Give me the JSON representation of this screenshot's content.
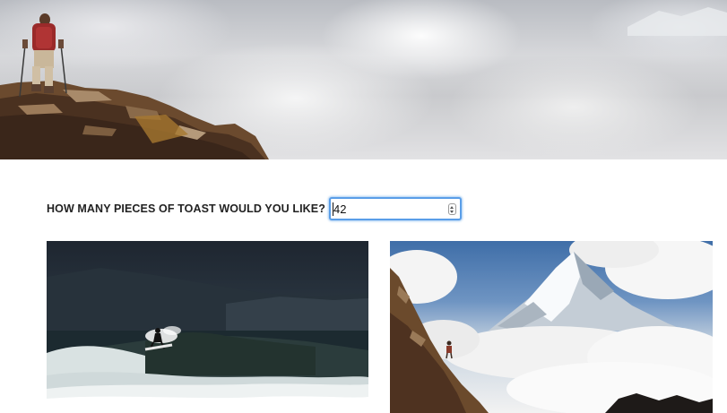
{
  "hero": {
    "image": "hiker-on-rocky-ridge-above-clouds"
  },
  "form": {
    "question_label": "HOW MANY PIECES OF TOAST WOULD YOU LIKE?",
    "toast_count_value": "42"
  },
  "gallery": {
    "left_image": "surfer-riding-dark-wave",
    "right_image": "snowy-mountain-peak-with-hiker"
  },
  "colors": {
    "input_focus_border": "#5a9ee8",
    "label_text": "#222222"
  }
}
